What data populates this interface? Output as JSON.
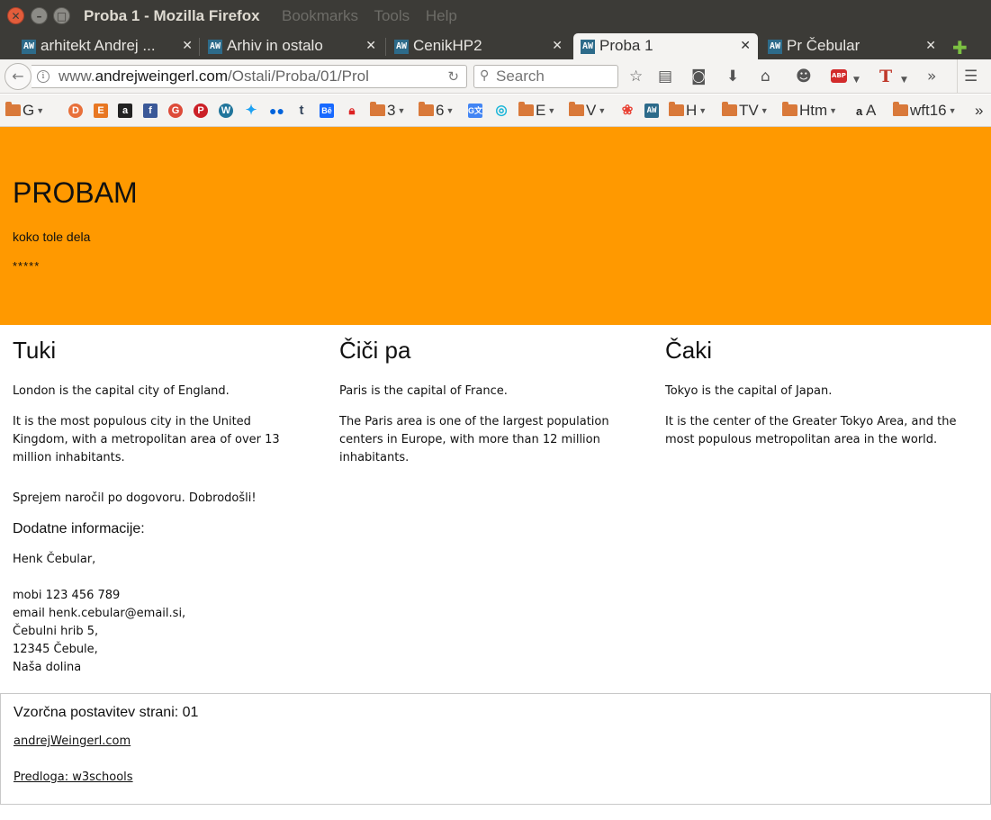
{
  "window": {
    "title": "Proba 1 - Mozilla Firefox",
    "menu_ghost": [
      "Bookmarks",
      "Tools",
      "Help"
    ]
  },
  "tabs": [
    {
      "label": "arhitekt Andrej ...",
      "icon": "AW",
      "active": false
    },
    {
      "label": "Arhiv in ostalo",
      "icon": "AW",
      "active": false
    },
    {
      "label": "CenikHP2",
      "icon": "AW",
      "active": false
    },
    {
      "label": "Proba 1",
      "icon": "AW",
      "active": true
    },
    {
      "label": "Pr Čebular",
      "icon": "AW",
      "active": false
    }
  ],
  "navbar": {
    "url_prefix": "www.",
    "url_host": "andrejweingerl.com",
    "url_path": "/Ostali/Proba/01/Prol",
    "search_placeholder": "Search"
  },
  "bookmarks": {
    "g": "G",
    "three": "3",
    "six": "6",
    "e": "E",
    "v": "V",
    "h": "H",
    "tv": "TV",
    "htm": "Htm",
    "a": "A",
    "wft16": "wft16"
  },
  "page": {
    "hero": {
      "title": "PROBAM",
      "subtitle": "koko tole dela",
      "stars": "*****"
    },
    "columns": [
      {
        "heading": "Tuki",
        "p1": "London is the capital city of England.",
        "p2": "It is the most populous city in the United Kingdom, with a metropolitan area of over 13 million inhabitants."
      },
      {
        "heading": "Čiči pa",
        "p1": "Paris is the capital of France.",
        "p2": "The Paris area is one of the largest population centers in Europe, with more than 12 million inhabitants."
      },
      {
        "heading": "Čaki",
        "p1": "Tokyo is the capital of Japan.",
        "p2": "It is the center of the Greater Tokyo Area, and the most populous metropolitan area in the world."
      }
    ],
    "welcome": "Sprejem naročil po dogovoru. Dobrodošli!",
    "extra_heading": "Dodatne informacije:",
    "contact": {
      "name": "Henk Čebular,",
      "mobile": "mobi 123 456 789",
      "email": "email henk.cebular@email.si,",
      "street": "Čebulni hrib 5,",
      "city": "12345 Čebule,",
      "region": "Naša dolina"
    },
    "footer": {
      "title": "Vzorčna postavitev strani: 01",
      "link1": "andrejWeingerl.com",
      "link2": "Predloga: w3schools"
    }
  },
  "colors": {
    "hero_bg": "#ff9900",
    "titlebar_bg": "#3c3b37",
    "toolbar_bg": "#f4f3f1"
  }
}
